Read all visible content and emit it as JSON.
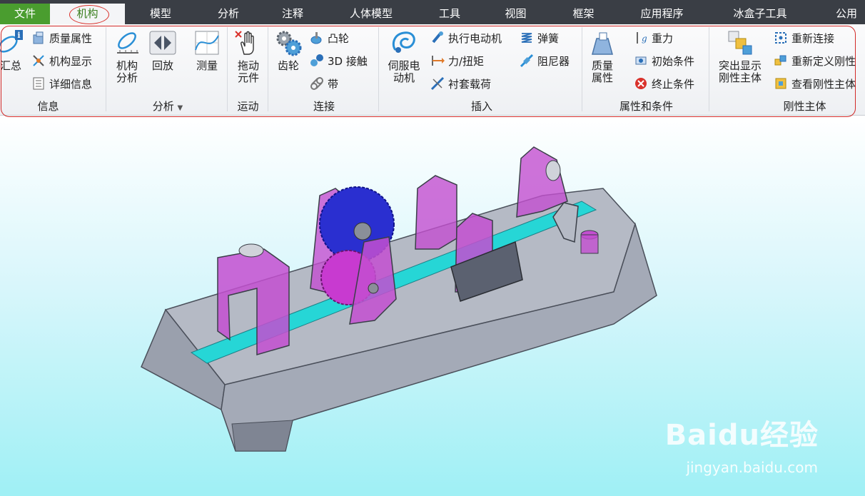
{
  "menu": {
    "tabs": [
      "文件",
      "机构",
      "模型",
      "分析",
      "注释",
      "人体模型",
      "工具",
      "视图",
      "框架",
      "应用程序",
      "冰盒子工具",
      "公用"
    ]
  },
  "ribbon": {
    "info": {
      "label": "信息",
      "summary": "汇总",
      "mass_props": "质量属性",
      "mech_display": "机构显示",
      "details": "详细信息"
    },
    "analysis": {
      "label": "分析",
      "mech_analysis": "机构\n分析",
      "playback": "回放",
      "measure": "测量"
    },
    "motion": {
      "label": "运动",
      "drag": "拖动\n元件"
    },
    "connect": {
      "label": "连接",
      "gear": "齿轮",
      "cam": "凸轮",
      "contact3d": "3D 接触",
      "belt": "带"
    },
    "insert": {
      "label": "插入",
      "servo": "伺服电\n动机",
      "actuator": "执行电动机",
      "force": "力/扭矩",
      "bushing": "衬套载荷",
      "spring": "弹簧",
      "damper": "阻尼器"
    },
    "props": {
      "label": "属性和条件",
      "mass": "质量\n属性",
      "gravity": "重力",
      "initial": "初始条件",
      "terminate": "终止条件"
    },
    "bodies": {
      "label": "刚性主体",
      "highlight": "突出显示\n刚性主体",
      "reconnect": "重新连接",
      "redefine": "重新定义刚性",
      "view": "查看刚性主体"
    }
  },
  "watermark": {
    "brand": "Baidu经验",
    "url": "jingyan.baidu.com"
  }
}
